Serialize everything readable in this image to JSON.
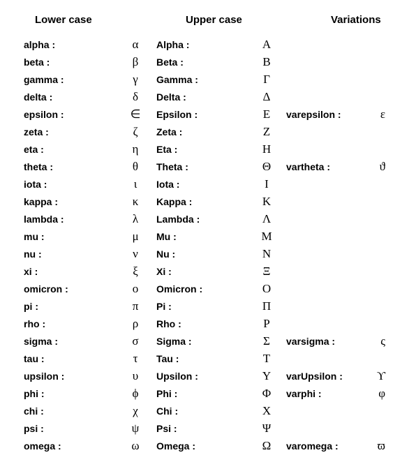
{
  "headers": {
    "lower": "Lower case",
    "upper": "Upper case",
    "variations": "Variations"
  },
  "rows": [
    {
      "lower_name": "alpha :",
      "lower_sym": "α",
      "upper_name": "Alpha :",
      "upper_sym": "Α",
      "var_name": "",
      "var_sym": ""
    },
    {
      "lower_name": "beta :",
      "lower_sym": "β",
      "upper_name": "Beta :",
      "upper_sym": "Β",
      "var_name": "",
      "var_sym": ""
    },
    {
      "lower_name": "gamma :",
      "lower_sym": "γ",
      "upper_name": "Gamma :",
      "upper_sym": "Γ",
      "var_name": "",
      "var_sym": ""
    },
    {
      "lower_name": "delta :",
      "lower_sym": "δ",
      "upper_name": "Delta :",
      "upper_sym": "Δ",
      "var_name": "",
      "var_sym": ""
    },
    {
      "lower_name": "epsilon :",
      "lower_sym": "∈",
      "upper_name": "Epsilon :",
      "upper_sym": "Ε",
      "var_name": "varepsilon :",
      "var_sym": "ε"
    },
    {
      "lower_name": "zeta :",
      "lower_sym": "ζ",
      "upper_name": "Zeta :",
      "upper_sym": "Ζ",
      "var_name": "",
      "var_sym": ""
    },
    {
      "lower_name": "eta :",
      "lower_sym": "η",
      "upper_name": "Eta :",
      "upper_sym": "Η",
      "var_name": "",
      "var_sym": ""
    },
    {
      "lower_name": "theta :",
      "lower_sym": "θ",
      "upper_name": "Theta :",
      "upper_sym": "Θ",
      "var_name": "vartheta :",
      "var_sym": "ϑ"
    },
    {
      "lower_name": "iota :",
      "lower_sym": "ι",
      "upper_name": "Iota :",
      "upper_sym": "Ι",
      "var_name": "",
      "var_sym": ""
    },
    {
      "lower_name": "kappa :",
      "lower_sym": "κ",
      "upper_name": "Kappa :",
      "upper_sym": "Κ",
      "var_name": "",
      "var_sym": ""
    },
    {
      "lower_name": "lambda :",
      "lower_sym": "λ",
      "upper_name": "Lambda :",
      "upper_sym": "Λ",
      "var_name": "",
      "var_sym": ""
    },
    {
      "lower_name": "mu :",
      "lower_sym": "μ",
      "upper_name": "Mu :",
      "upper_sym": "Μ",
      "var_name": "",
      "var_sym": ""
    },
    {
      "lower_name": "nu :",
      "lower_sym": "ν",
      "upper_name": "Nu :",
      "upper_sym": "Ν",
      "var_name": "",
      "var_sym": ""
    },
    {
      "lower_name": "xi :",
      "lower_sym": "ξ",
      "upper_name": "Xi :",
      "upper_sym": "Ξ",
      "var_name": "",
      "var_sym": ""
    },
    {
      "lower_name": "omicron :",
      "lower_sym": "ο",
      "upper_name": "Omicron :",
      "upper_sym": "Ο",
      "var_name": "",
      "var_sym": ""
    },
    {
      "lower_name": "pi :",
      "lower_sym": "π",
      "upper_name": "Pi :",
      "upper_sym": "Π",
      "var_name": "",
      "var_sym": ""
    },
    {
      "lower_name": "rho :",
      "lower_sym": "ρ",
      "upper_name": "Rho :",
      "upper_sym": "Ρ",
      "var_name": "",
      "var_sym": ""
    },
    {
      "lower_name": "sigma :",
      "lower_sym": "σ",
      "upper_name": "Sigma :",
      "upper_sym": "Σ",
      "var_name": "varsigma :",
      "var_sym": "ς"
    },
    {
      "lower_name": "tau :",
      "lower_sym": "τ",
      "upper_name": "Tau :",
      "upper_sym": "Τ",
      "var_name": "",
      "var_sym": ""
    },
    {
      "lower_name": "upsilon :",
      "lower_sym": "υ",
      "upper_name": "Upsilon :",
      "upper_sym": "Υ",
      "var_name": "varUpsilon :",
      "var_sym": "ϒ"
    },
    {
      "lower_name": "phi :",
      "lower_sym": "ϕ",
      "upper_name": "Phi :",
      "upper_sym": "Φ",
      "var_name": "varphi :",
      "var_sym": "φ"
    },
    {
      "lower_name": "chi :",
      "lower_sym": "χ",
      "upper_name": "Chi :",
      "upper_sym": "Χ",
      "var_name": "",
      "var_sym": ""
    },
    {
      "lower_name": "psi :",
      "lower_sym": "ψ",
      "upper_name": "Psi :",
      "upper_sym": "Ψ",
      "var_name": "",
      "var_sym": ""
    },
    {
      "lower_name": "omega :",
      "lower_sym": "ω",
      "upper_name": "Omega :",
      "upper_sym": "Ω",
      "var_name": "varomega :",
      "var_sym": "ϖ"
    }
  ]
}
